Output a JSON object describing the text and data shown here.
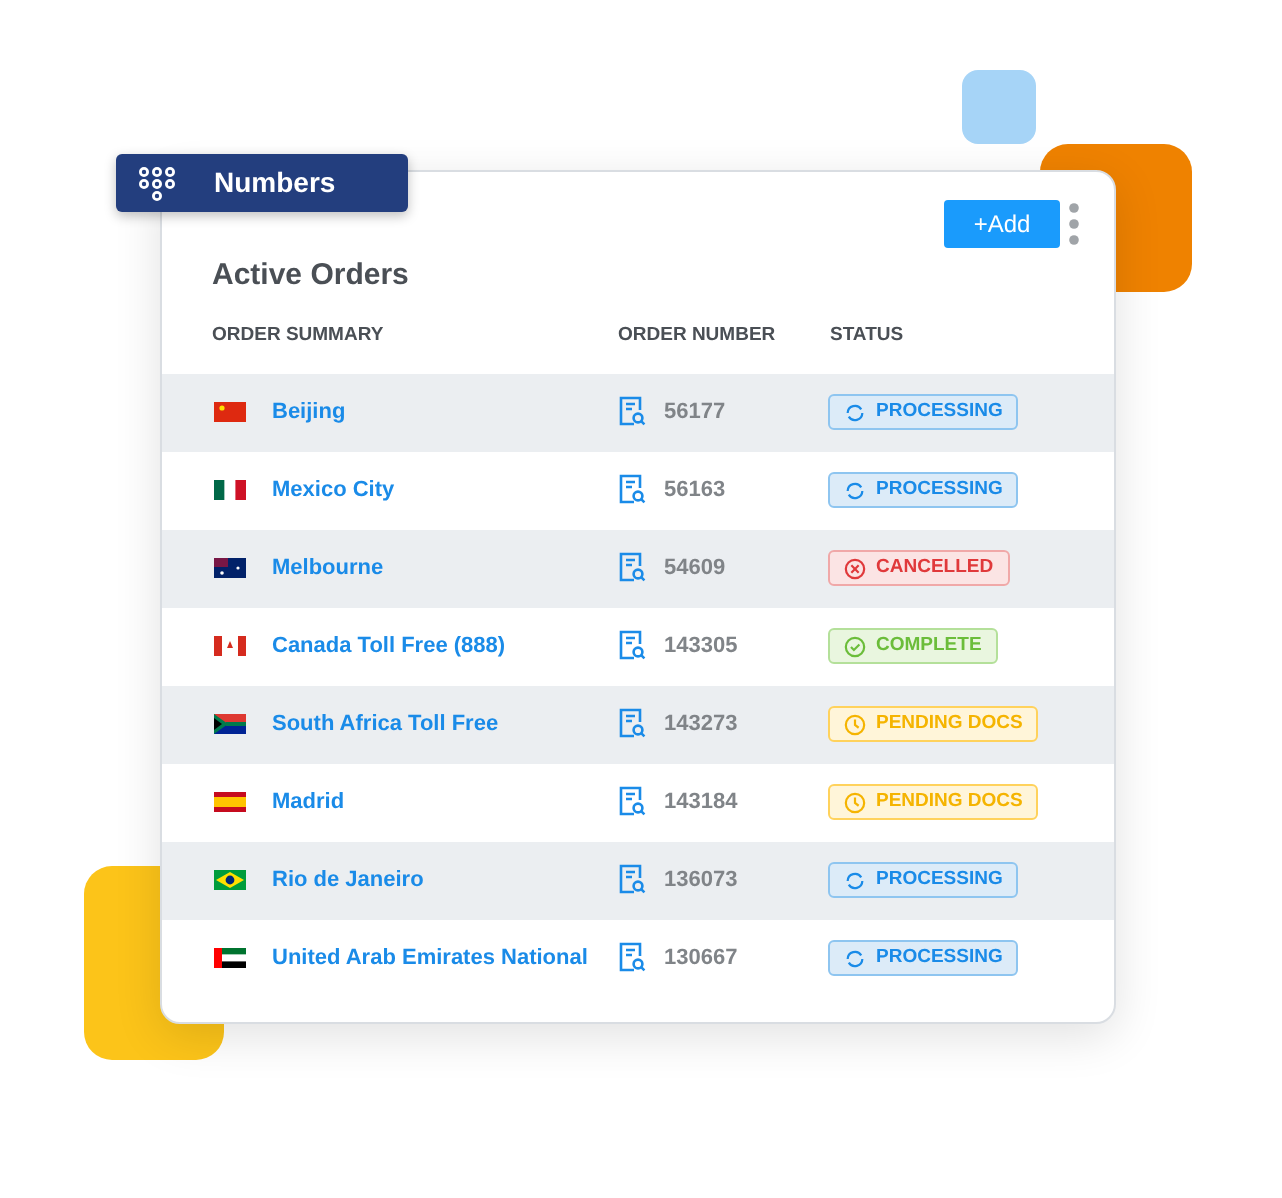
{
  "badge": {
    "label": "Numbers"
  },
  "card": {
    "title": "Active Orders",
    "add_button": "+Add"
  },
  "columns": [
    "ORDER SUMMARY",
    "ORDER NUMBER",
    "STATUS"
  ],
  "rows": [
    {
      "kind": "cn",
      "name": "Beijing",
      "number": "56177",
      "status": {
        "kind": "processing",
        "label": "PROCESSING"
      }
    },
    {
      "kind": "mx",
      "name": "Mexico City",
      "number": "56163",
      "status": {
        "kind": "processing",
        "label": "PROCESSING"
      }
    },
    {
      "kind": "au",
      "name": "Melbourne",
      "number": "54609",
      "status": {
        "kind": "cancelled",
        "label": "CANCELLED"
      }
    },
    {
      "kind": "ca",
      "name": "Canada Toll Free (888)",
      "number": "143305",
      "status": {
        "kind": "complete",
        "label": "COMPLETE"
      }
    },
    {
      "kind": "za",
      "name": "South Africa Toll Free",
      "number": "143273",
      "status": {
        "kind": "pending",
        "label": "PENDING DOCS"
      }
    },
    {
      "kind": "es",
      "name": "Madrid",
      "number": "143184",
      "status": {
        "kind": "pending",
        "label": "PENDING DOCS"
      }
    },
    {
      "kind": "br",
      "name": "Rio de Janeiro",
      "number": "136073",
      "status": {
        "kind": "processing",
        "label": "PROCESSING"
      }
    },
    {
      "kind": "ae",
      "name": "United Arab Emirates National",
      "number": "130667",
      "status": {
        "kind": "processing",
        "label": "PROCESSING"
      }
    }
  ]
}
